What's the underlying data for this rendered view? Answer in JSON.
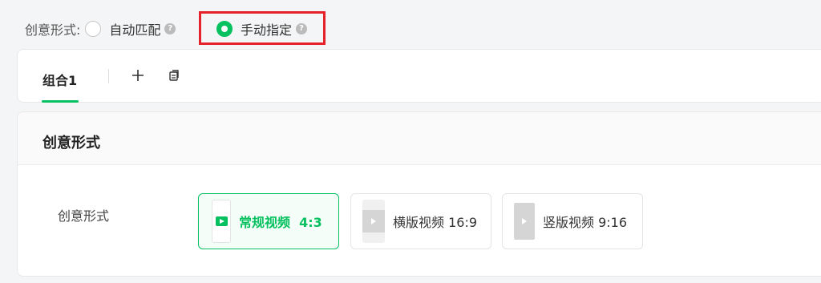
{
  "mode": {
    "label": "创意形式:",
    "auto_label": "自动匹配",
    "manual_label": "手动指定",
    "selected": "manual"
  },
  "tabs": {
    "items": [
      {
        "label": "组合1",
        "active": true
      }
    ]
  },
  "creative": {
    "section_title": "创意形式",
    "field_label": "创意形式",
    "options": [
      {
        "label": "常规视频  4:3",
        "selected": true
      },
      {
        "label": "横版视频 16:9",
        "selected": false
      },
      {
        "label": "竖版视频 9:16",
        "selected": false
      }
    ]
  },
  "colors": {
    "accent": "#07c160",
    "highlight": "#e5212b"
  }
}
